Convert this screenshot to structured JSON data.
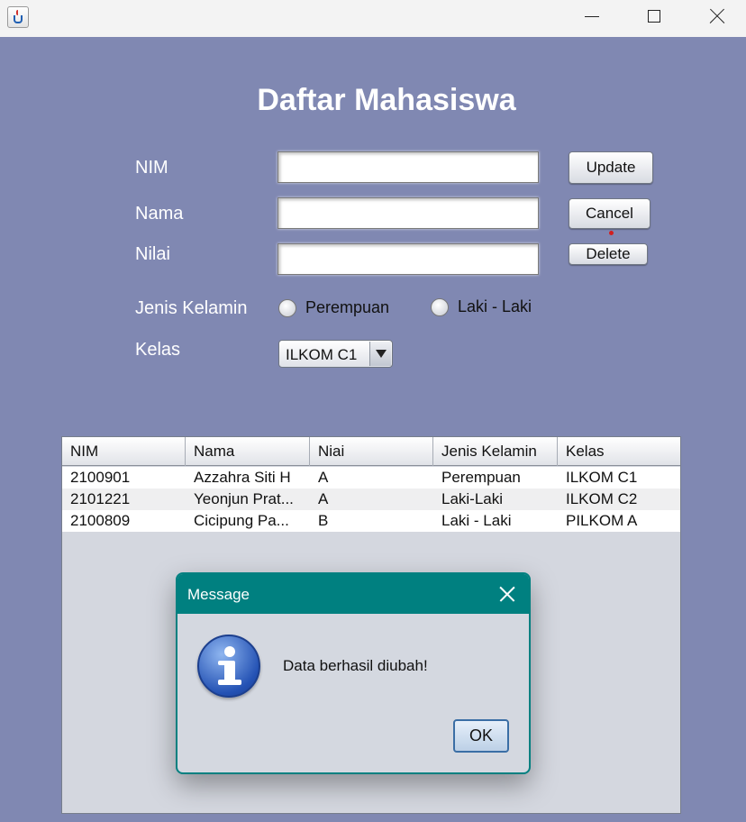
{
  "window": {
    "title": "",
    "icon": "java-cup-icon"
  },
  "page": {
    "title": "Daftar Mahasiswa"
  },
  "form": {
    "nim_label": "NIM",
    "nama_label": "Nama",
    "nilai_label": "Nilai",
    "jenis_kelamin_label": "Jenis Kelamin",
    "kelas_label": "Kelas",
    "nim_value": "",
    "nama_value": "",
    "nilai_value": "",
    "gender_options": [
      "Perempuan",
      "Laki - Laki"
    ],
    "kelas_selected": "ILKOM C1"
  },
  "buttons": {
    "update": "Update",
    "cancel": "Cancel",
    "delete": "Delete"
  },
  "table": {
    "columns": [
      "NIM",
      "Nama",
      "Niai",
      "Jenis Kelamin",
      "Kelas"
    ],
    "rows": [
      [
        "2100901",
        "Azzahra Siti H",
        "A",
        "Perempuan",
        "ILKOM C1"
      ],
      [
        "2101221",
        "Yeonjun Prat...",
        "A",
        "Laki-Laki",
        "ILKOM C2"
      ],
      [
        "2100809",
        "Cicipung Pa...",
        "B",
        "Laki - Laki",
        "PILKOM A"
      ]
    ]
  },
  "dialog": {
    "title": "Message",
    "message": "Data berhasil diubah!",
    "ok_label": "OK",
    "icon": "info-icon",
    "title_bar_color": "#008080"
  },
  "colors": {
    "background": "#8088b2",
    "dialog_accent": "#008080"
  }
}
